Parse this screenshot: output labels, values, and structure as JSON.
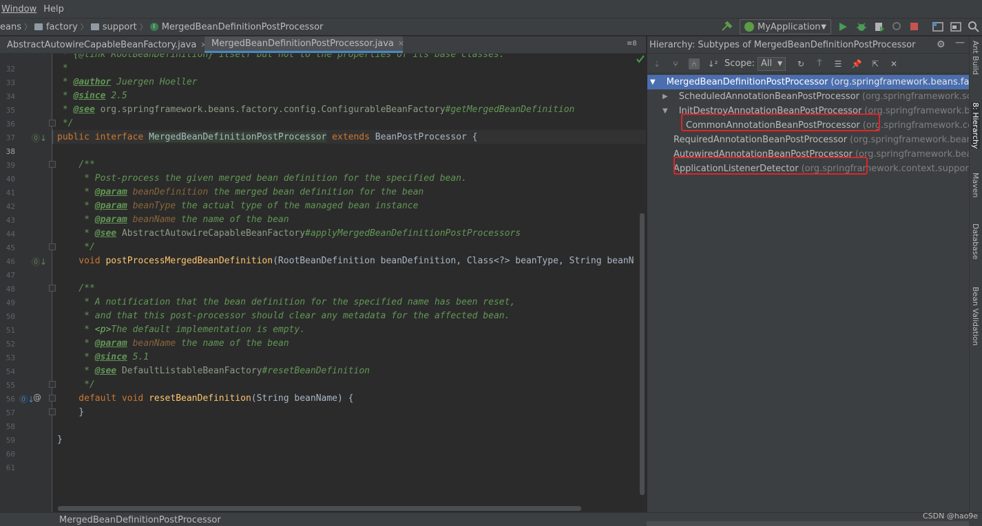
{
  "menu": [
    "Window",
    "Help"
  ],
  "breadcrumb": [
    "eans",
    "factory",
    "support",
    "MergedBeanDefinitionPostProcessor"
  ],
  "run_config": "MyApplication",
  "tabs": [
    {
      "label": "AbstractAutowireCapableBeanFactory.java",
      "active": false
    },
    {
      "label": "MergedBeanDefinitionPostProcessor.java",
      "active": true
    }
  ],
  "tab_overflow": "≡8",
  "editor": {
    "lines": [
      {
        "no": "",
        "html": "cmt-top"
      },
      {
        "no": "32"
      },
      {
        "no": "33"
      },
      {
        "no": "34"
      },
      {
        "no": "35"
      },
      {
        "no": "36"
      },
      {
        "no": "37"
      },
      {
        "no": "38"
      },
      {
        "no": "39"
      },
      {
        "no": "40"
      },
      {
        "no": "41"
      },
      {
        "no": "42"
      },
      {
        "no": "43"
      },
      {
        "no": "44"
      },
      {
        "no": "45"
      },
      {
        "no": "46"
      },
      {
        "no": "47"
      },
      {
        "no": "48"
      },
      {
        "no": "49"
      },
      {
        "no": "50"
      },
      {
        "no": "51"
      },
      {
        "no": "52"
      },
      {
        "no": "53"
      },
      {
        "no": "54"
      },
      {
        "no": "55"
      },
      {
        "no": "56"
      },
      {
        "no": "57"
      },
      {
        "no": "58"
      },
      {
        "no": "59"
      },
      {
        "no": "60"
      },
      {
        "no": "61"
      }
    ],
    "text": {
      "l31": " * {@link RootBeanDefinition} itself but not to the properties of its base classes.",
      "l32": " *",
      "l33_tag": "@author",
      "l33_rest": " Juergen Hoeller",
      "l34_tag": "@since",
      "l34_rest": " 2.5",
      "l35_tag": "@see",
      "l35_ref": " org.springframework.beans.factory.config.ConfigurableBeanFactory",
      "l35_rest": "#getMergedBeanDefinition",
      "l36": " */",
      "l37_kw1": "public interface ",
      "l37_name": "MergedBeanDefinitionPostProcessor",
      "l37_kw2": " extends ",
      "l37_rest": "BeanPostProcessor {",
      "l39": "    /**",
      "l40": "     * Post-process the given merged bean definition for the specified bean.",
      "l41_tag": "@param",
      "l41_p": " beanDefinition",
      "l41_rest": " the merged bean definition for the bean",
      "l42_tag": "@param",
      "l42_p": " beanType",
      "l42_rest": " the actual type of the managed bean instance",
      "l43_tag": "@param",
      "l43_p": " beanName",
      "l43_rest": " the name of the bean",
      "l44_tag": "@see",
      "l44_ref": " AbstractAutowireCapableBeanFactory",
      "l44_rest": "#applyMergedBeanDefinitionPostProcessors",
      "l45": "     */",
      "l46_kw": "    void ",
      "l46_fn": "postProcessMergedBeanDefinition",
      "l46_rest": "(RootBeanDefinition beanDefinition, Class<?> beanType, String beanN",
      "l48": "    /**",
      "l49": "     * A notification that the bean definition for the specified name has been reset,",
      "l50": "     * and that this post-processor should clear any metadata for the affected bean.",
      "l51_pre": "     * ",
      "l51_tag": "<p>",
      "l51_rest": "The default implementation is empty.",
      "l52_tag": "@param",
      "l52_p": " beanName",
      "l52_rest": " the name of the bean",
      "l53_tag": "@since",
      "l53_rest": " 5.1",
      "l54_tag": "@see",
      "l54_ref": " DefaultListableBeanFactory",
      "l54_rest": "#resetBeanDefinition",
      "l55": "     */",
      "l56_kw": "    default void ",
      "l56_fn": "resetBeanDefinition",
      "l56_rest": "(String beanName) {",
      "l57": "    }",
      "l59": "}"
    }
  },
  "status_text": "MergedBeanDefinitionPostProcessor",
  "hierarchy": {
    "title": "Hierarchy:  Subtypes of MergedBeanDefinitionPostProcessor",
    "scope_label": "Scope:",
    "scope_value": "All",
    "nodes": [
      {
        "name": "MergedBeanDefinitionPostProcessor",
        "pkg": "(org.springframework.beans.fac",
        "selected": true,
        "arrow": "▼",
        "indent": 0
      },
      {
        "name": "ScheduledAnnotationBeanPostProcessor",
        "pkg": "(org.springframework.sche",
        "arrow": "▶",
        "indent": 1
      },
      {
        "name": "InitDestroyAnnotationBeanPostProcessor",
        "pkg": "(org.springframework.bea",
        "arrow": "▼",
        "indent": 1
      },
      {
        "name": "CommonAnnotationBeanPostProcessor",
        "pkg": "(org.springframework.co",
        "arrow": "",
        "indent": 2,
        "boxed": true
      },
      {
        "name": "RequiredAnnotationBeanPostProcessor",
        "pkg": "(org.springframework.beans",
        "arrow": "",
        "indent": 1
      },
      {
        "name": "AutowiredAnnotationBeanPostProcessor",
        "pkg": "(org.springframework.bean",
        "arrow": "",
        "indent": 1,
        "boxed": true
      },
      {
        "name": "ApplicationListenerDetector",
        "pkg": "(org.springframework.context.support)",
        "arrow": "",
        "indent": 1
      }
    ]
  },
  "right_strip": [
    "Ant Build",
    "8: Hierarchy",
    "Maven",
    "Database",
    "Bean Validation"
  ],
  "watermark": "CSDN @hao9e",
  "colors": {
    "accent": "#4b6eaf",
    "highlight_box": "#e0252a",
    "comment": "#629755",
    "keyword": "#cc7832",
    "method": "#ffc66d"
  }
}
